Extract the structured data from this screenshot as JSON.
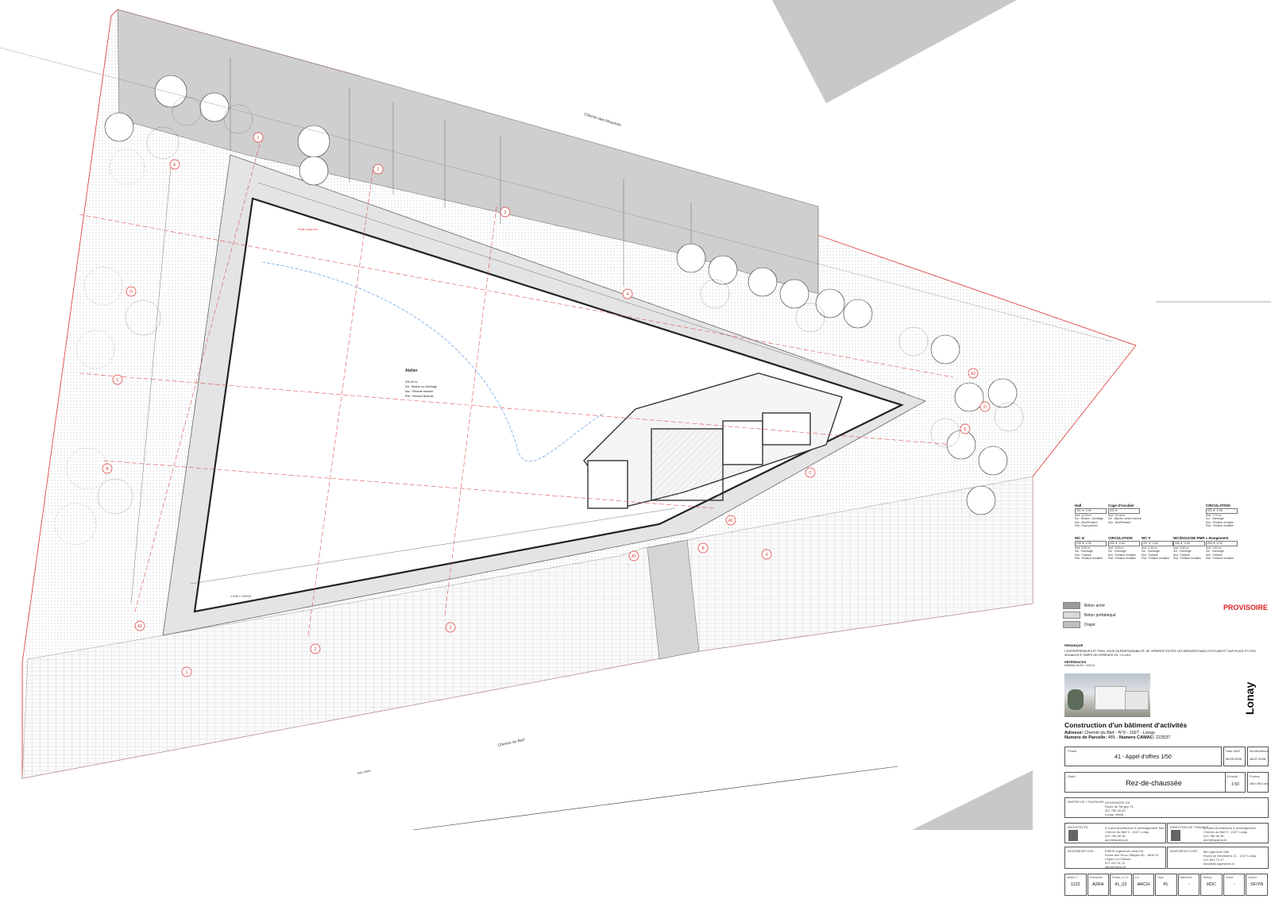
{
  "plan": {
    "street_top": "Chemin des Mouches",
    "street_bottom": "Chemin du Bief",
    "street_bottom_left": "Axe route",
    "room_atelier": {
      "name": "Atelier",
      "surface": "326,29 m²",
      "sol": "Sol : Résine ou Carrelage",
      "mur": "Mur : Peinture blanche",
      "plaf": "Plaf : Peinture Blanche"
    },
    "level_main": "± 0.00 = +375.21",
    "axis_letters": [
      "A1",
      "B",
      "C",
      "D",
      "E",
      "A2",
      "C",
      "D",
      "E",
      "A1",
      "A2",
      "B"
    ],
    "axis_numbers": [
      "1",
      "2",
      "3",
      "4",
      "1",
      "2",
      "3",
      "4"
    ],
    "fire_line_label": "Porte coupe-feu"
  },
  "rooms_table": [
    {
      "title": "Hall",
      "lines": [
        "001  ▼ -0.06",
        "Surf: 11,22 m²",
        "Sol : Résine / Carrelage",
        "Mur : Brut/Peinture",
        "Plaf : Faux-plafond"
      ]
    },
    {
      "title": "Cage d'escalier",
      "lines": [
        "003  ▼",
        "Surf: 10,16 m²",
        "Sol : Marche contre-marche",
        "Mur : Brut/Peinture",
        ""
      ]
    },
    {
      "title": "CIRCULATION",
      "lines": [
        "004  ▼ -0.06",
        "Surf: 7,70 m²",
        "Sol : Carrelage",
        "Mur : Peinture émaillée",
        "Plaf : Peinture émaillée"
      ]
    },
    {
      "title": "WC H",
      "lines": [
        "005  ▼ -0.06",
        "Surf: 3,09 m²",
        "Sol : Carrelage",
        "Mur : Faïence",
        "Plaf : Peinture émaillée"
      ]
    },
    {
      "title": "CIRCULATION",
      "lines": [
        "006  ▼ -0.06",
        "Surf: 3,53 m²",
        "Sol : Carrelage",
        "Mur : Peinture émaillée",
        "Plaf : Peinture émaillée"
      ]
    },
    {
      "title": "WC F",
      "lines": [
        "007  ▼ -0.06",
        "Surf: 2,36 m²",
        "Sol : Carrelage",
        "Mur : Faïence",
        "Plaf : Peinture émaillée"
      ]
    },
    {
      "title": "WC/DOUCHE PMR",
      "lines": [
        "008  ▼ -0.06",
        "Surf: 3,80 m²",
        "Sol : Carrelage",
        "Mur : Faïence",
        "Plaf : Peinture émaillée"
      ]
    },
    {
      "title": "L.Rangement",
      "lines": [
        "009  ▼ -0.06",
        "Surf: 4,93 m²",
        "Sol : Carrelage",
        "Mur : Faïence",
        "Plaf : Peinture émaillée"
      ]
    }
  ],
  "legend": [
    {
      "label": "Béton armé",
      "swatch": "#9a9a9a"
    },
    {
      "label": "Béton préfabriqué",
      "swatch": "#d9d9d9"
    },
    {
      "label": "Drapé",
      "swatch": "#bdbdbd"
    }
  ],
  "status_stamp": "PROVISOIRE",
  "remark": {
    "title": "REMARQUE",
    "text": "L'ENTREPRENEUR EST TENU, SOUS SA RESPONSABILITÉ, DE VÉRIFIER TOUTES LES MESURES DANS LES PLANS ET SUR PLACE ET D'EN SIGNALER À TEMPS LES ERREURS S'IL Y A LIEU.",
    "ref_title": "RÉFÉRENCES",
    "ref_text": "NIVEAU ±0.00 = 375.21"
  },
  "project": {
    "location": "Lonay",
    "title": "Construction d'un bâtiment d'activités",
    "address_label": "Adresse:",
    "address": "Chemin du Bief - N°9 - 1027 - Lonay",
    "parcel_label": "Numero de Parcelle:",
    "parcel": "485",
    "camac_label": "Numero CAMAC:",
    "camac": "222537"
  },
  "titleblock": {
    "phase_label": "Phase",
    "phase": "41 - Appel d'offres 1/50",
    "date_label": "Date MAE",
    "date": "06.03.2025",
    "mod_label": "Modifications",
    "mod": "18.07.2025",
    "objet_label": "Objet",
    "objet": "Rez-de-chaussée",
    "echelle_label": "Echelle",
    "echelle": "1:50",
    "format_label": "Format",
    "format": "100 x 59.4 cm",
    "maitre_label": "MAÎTRE DE L'OUVRAGE",
    "maitre_lines": [
      "GEVASAGRE SA",
      "Route de Sergey 74",
      "021 785 35 60",
      "Lonay, info@..."
    ],
    "architecte_label": "ARCHITECTE",
    "architecte_lines": [
      "A.Carrà Architecture & aménagement Sàrl",
      "Chemin du Bief 9 - 1027 Lonay",
      "021 786 56 36",
      "archi@acarra.ch"
    ],
    "direction_label": "DIRECTION DE TRAVAUX",
    "direction_lines": [
      "A.Carrà Architecture & aménagement",
      "Chemin du Bief 9 - 1027 Lonay",
      "021 786 56 36",
      "archi@acarra.ch"
    ],
    "civil_label": "INGÉNIEUR CIVIL :",
    "civil_lines": [
      "EMESI ingénieurs civils SA",
      "Route des Deux-Villages 60 - 1806 St-",
      "Légier-La Chiésaz",
      "021 923 51 11",
      "info@emesi.ch"
    ],
    "cvse_label": "INGÉNIEUR CVSE :",
    "cvse_lines": [
      "Bill Ingénierie Sàrl",
      "Route de Bremblens 11 - 1027 Lonay",
      "021 803 70 47",
      "info@bill-ingenierie.ch"
    ],
    "codes": [
      {
        "label": "Affaire n°",
        "value": "1122"
      },
      {
        "label": "Entreprise",
        "value": "A2RA"
      },
      {
        "label": "Phase_n.n.n",
        "value": "41_02"
      },
      {
        "label": "Lot",
        "value": "ARCH"
      },
      {
        "label": "Type",
        "value": "PL"
      },
      {
        "label": "Bâtiment",
        "value": "-"
      },
      {
        "label": "Niveau",
        "value": "RDC"
      },
      {
        "label": "Indice",
        "value": "-"
      },
      {
        "label": "Auteur",
        "value": "SF/YR"
      }
    ]
  }
}
